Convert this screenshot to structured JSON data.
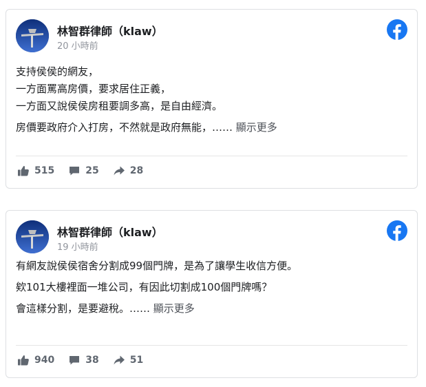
{
  "posts": [
    {
      "author": "林智群律師（klaw）",
      "time": "20 小時前",
      "lines": [
        "支持侯侯的網友，",
        "一方面罵高房價，要求居住正義，",
        "一方面又說侯侯房租要調多高，是自由經濟。"
      ],
      "last_line": "房價要政府介入打房，不然就是政府無能，……",
      "see_more": "顯示更多",
      "likes": "515",
      "comments": "25",
      "shares": "28"
    },
    {
      "author": "林智群律師（klaw）",
      "time": "19 小時前",
      "lines": [
        "有網友說侯侯宿舍分割成99個門牌，是為了讓學生收信方便。",
        "欸101大樓裡面一堆公司，有因此切割成100個門牌嗎？"
      ],
      "last_line": "會這樣分割，是要避稅。……",
      "see_more": "顯示更多",
      "likes": "940",
      "comments": "38",
      "shares": "51"
    }
  ],
  "icons": {
    "facebook": "facebook-logo-icon",
    "like": "thumbs-up-icon",
    "comment": "comment-bubble-icon",
    "share": "share-arrow-icon"
  },
  "colors": {
    "facebook_blue": "#1877f2",
    "meta_gray": "#606770",
    "time_gray": "#90949c",
    "border": "#dddfe2"
  }
}
